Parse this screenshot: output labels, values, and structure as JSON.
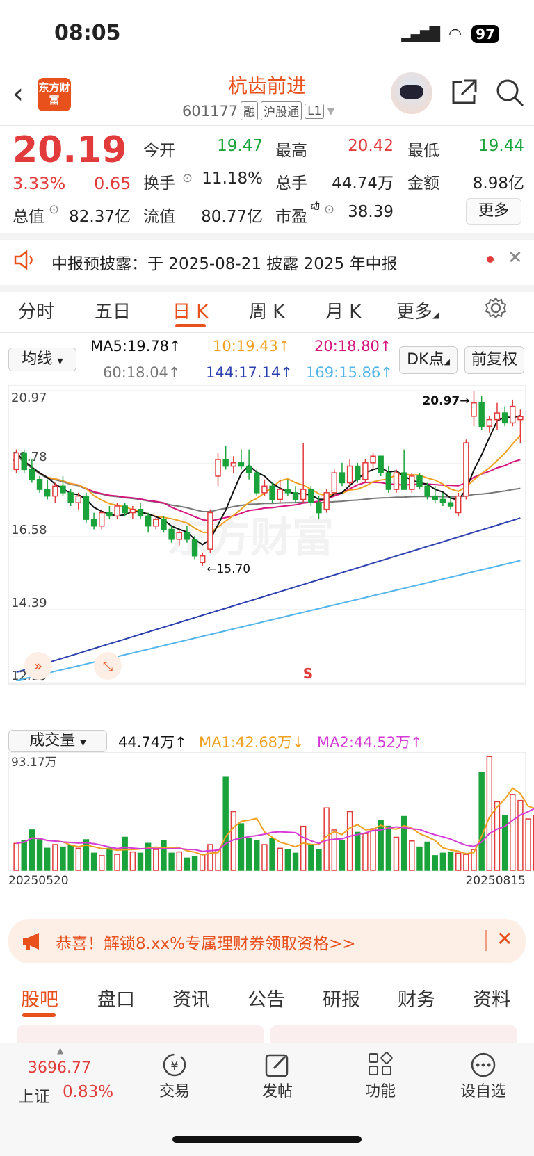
{
  "status": {
    "time": "08:05",
    "battery": "97"
  },
  "header": {
    "stock_name": "杭齿前进",
    "code": "601177",
    "tags": [
      "融",
      "沪股通",
      "L1"
    ],
    "logo_text": "东方财富"
  },
  "quote": {
    "price": "20.19",
    "pct": "3.33%",
    "chg": "0.65",
    "fields": [
      {
        "label": "今开",
        "value": "19.47",
        "color": "green"
      },
      {
        "label": "最高",
        "value": "20.42",
        "color": "red"
      },
      {
        "label": "最低",
        "value": "19.44",
        "color": "green"
      },
      {
        "label": "换手",
        "value": "11.18%",
        "color": "black"
      },
      {
        "label": "总手",
        "value": "44.74万",
        "color": "black"
      },
      {
        "label": "金额",
        "value": "8.98亿",
        "color": "black"
      },
      {
        "label": "总值",
        "value": "82.37亿",
        "color": "black"
      },
      {
        "label": "流值",
        "value": "80.77亿",
        "color": "black"
      },
      {
        "label": "市盈",
        "value": "38.39",
        "color": "black"
      }
    ],
    "pe_sup": "动",
    "more_label": "更多"
  },
  "notice": {
    "text": "中报预披露：于 2025-08-21 披露 2025 年中报"
  },
  "tabs": [
    "分时",
    "五日",
    "日 K",
    "周 K",
    "月 K",
    "更多"
  ],
  "active_tab": "日 K",
  "ma_selector": "均线",
  "ma": {
    "ma5": "MA5:19.78↑",
    "ma10": "10:19.43↑",
    "ma20": "20:18.80↑",
    "ma60": "60:18.04↑",
    "ma144": "144:17.14↑",
    "ma169": "169:15.86↑"
  },
  "dk_button": "DK点",
  "adj_button": "前复权",
  "price_axis": [
    "20.97",
    "18.78",
    "16.58",
    "14.39",
    "12.19"
  ],
  "annotations": {
    "high": "20.97",
    "low": "15.70",
    "signal": "S"
  },
  "watermark": "东方财富",
  "volume": {
    "selector": "成交量",
    "value": "44.74万↑",
    "ma1": "MA1:42.68万↓",
    "ma2": "MA2:44.52万↑",
    "axis_max": "93.17万",
    "date_start": "20250520",
    "date_end": "20250815"
  },
  "chart_data": {
    "type": "candlestick",
    "ylim": [
      12.19,
      20.97
    ],
    "ohlc": [
      [
        18.6,
        19.2,
        18.5,
        19.1
      ],
      [
        19.1,
        19.2,
        18.5,
        18.6
      ],
      [
        18.6,
        18.9,
        18.2,
        18.3
      ],
      [
        18.3,
        18.4,
        17.9,
        18.0
      ],
      [
        18.0,
        18.3,
        17.7,
        17.8
      ],
      [
        17.8,
        18.2,
        17.6,
        18.1
      ],
      [
        18.1,
        18.4,
        17.8,
        17.9
      ],
      [
        17.9,
        18.0,
        17.5,
        17.6
      ],
      [
        17.6,
        17.9,
        17.4,
        17.8
      ],
      [
        17.8,
        17.9,
        17.0,
        17.1
      ],
      [
        17.1,
        17.3,
        16.8,
        16.9
      ],
      [
        16.9,
        17.4,
        16.8,
        17.3
      ],
      [
        17.3,
        17.5,
        17.1,
        17.2
      ],
      [
        17.2,
        17.6,
        17.1,
        17.5
      ],
      [
        17.5,
        17.6,
        17.2,
        17.3
      ],
      [
        17.3,
        17.5,
        17.1,
        17.4
      ],
      [
        17.4,
        17.6,
        17.1,
        17.2
      ],
      [
        17.2,
        17.3,
        16.7,
        16.9
      ],
      [
        16.9,
        17.2,
        16.8,
        17.1
      ],
      [
        17.1,
        17.2,
        16.7,
        16.8
      ],
      [
        16.8,
        16.9,
        16.4,
        16.5
      ],
      [
        16.5,
        16.8,
        16.3,
        16.7
      ],
      [
        16.7,
        16.9,
        16.4,
        16.5
      ],
      [
        16.5,
        16.6,
        15.9,
        16.0
      ],
      [
        15.8,
        16.1,
        15.7,
        16.0
      ],
      [
        16.2,
        17.4,
        16.1,
        17.3
      ],
      [
        18.4,
        19.1,
        18.1,
        18.9
      ],
      [
        18.9,
        19.3,
        18.6,
        18.7
      ],
      [
        18.7,
        19.0,
        18.5,
        18.8
      ],
      [
        18.8,
        19.2,
        18.6,
        18.7
      ],
      [
        18.7,
        19.2,
        18.3,
        18.5
      ],
      [
        18.5,
        18.6,
        17.8,
        17.9
      ],
      [
        17.9,
        18.3,
        17.8,
        18.1
      ],
      [
        18.1,
        18.2,
        17.6,
        17.7
      ],
      [
        17.7,
        18.3,
        17.6,
        18.0
      ],
      [
        18.0,
        18.3,
        17.8,
        17.9
      ],
      [
        17.9,
        18.1,
        17.6,
        17.7
      ],
      [
        17.7,
        19.4,
        17.6,
        18.0
      ],
      [
        18.0,
        18.1,
        17.5,
        17.6
      ],
      [
        17.6,
        17.8,
        17.1,
        17.3
      ],
      [
        17.4,
        18.0,
        17.3,
        17.9
      ],
      [
        17.9,
        18.6,
        17.8,
        18.5
      ],
      [
        18.5,
        18.8,
        18.1,
        18.2
      ],
      [
        18.2,
        18.9,
        18.1,
        18.7
      ],
      [
        18.7,
        18.8,
        18.2,
        18.3
      ],
      [
        18.3,
        18.9,
        18.2,
        18.8
      ],
      [
        18.8,
        19.1,
        18.6,
        19.0
      ],
      [
        19.0,
        19.0,
        18.4,
        18.5
      ],
      [
        18.5,
        18.7,
        17.9,
        18.0
      ],
      [
        18.0,
        18.6,
        17.9,
        18.5
      ],
      [
        18.5,
        19.2,
        18.4,
        18.0
      ],
      [
        18.0,
        18.5,
        17.9,
        18.4
      ],
      [
        18.4,
        18.5,
        18.0,
        18.1
      ],
      [
        18.1,
        18.2,
        17.7,
        17.8
      ],
      [
        17.8,
        18.1,
        17.6,
        17.7
      ],
      [
        17.7,
        17.9,
        17.5,
        17.6
      ],
      [
        17.6,
        17.8,
        17.4,
        17.5
      ],
      [
        17.3,
        17.9,
        17.2,
        17.8
      ],
      [
        17.8,
        19.5,
        17.7,
        19.4
      ],
      [
        20.2,
        20.97,
        19.9,
        20.6
      ],
      [
        20.6,
        20.8,
        19.8,
        19.9
      ],
      [
        19.9,
        20.2,
        19.7,
        20.1
      ],
      [
        20.1,
        20.6,
        19.8,
        20.3
      ],
      [
        20.3,
        20.5,
        19.9,
        20.0
      ],
      [
        20.0,
        20.7,
        19.9,
        20.5
      ],
      [
        20.1,
        20.4,
        19.4,
        20.19
      ]
    ],
    "volume": [
      22,
      24,
      33,
      25,
      18,
      21,
      19,
      20,
      18,
      25,
      14,
      12,
      18,
      13,
      27,
      15,
      14,
      22,
      17,
      24,
      14,
      15,
      10,
      11,
      13,
      21,
      17,
      76,
      48,
      38,
      26,
      24,
      21,
      26,
      18,
      17,
      14,
      36,
      21,
      17,
      51,
      33,
      24,
      48,
      31,
      30,
      34,
      41,
      36,
      27,
      44,
      24,
      19,
      23,
      12,
      14,
      15,
      14,
      13,
      17,
      80,
      93,
      56,
      45,
      62,
      57,
      42,
      45
    ],
    "vol_max": 93.17
  },
  "banner": {
    "text": "恭喜！解锁8.xx%专属理财券领取资格>>"
  },
  "subtabs": [
    "股吧",
    "盘口",
    "资讯",
    "公告",
    "研报",
    "财务",
    "资料"
  ],
  "bottom": {
    "index_value": "3696.77",
    "index_name": "上证",
    "index_pct": "0.83%",
    "items": [
      {
        "label": "交易",
        "icon": "yen-exchange-icon"
      },
      {
        "label": "发帖",
        "icon": "edit-icon"
      },
      {
        "label": "功能",
        "icon": "grid-icon"
      },
      {
        "label": "设自选",
        "icon": "more-icon"
      }
    ]
  }
}
